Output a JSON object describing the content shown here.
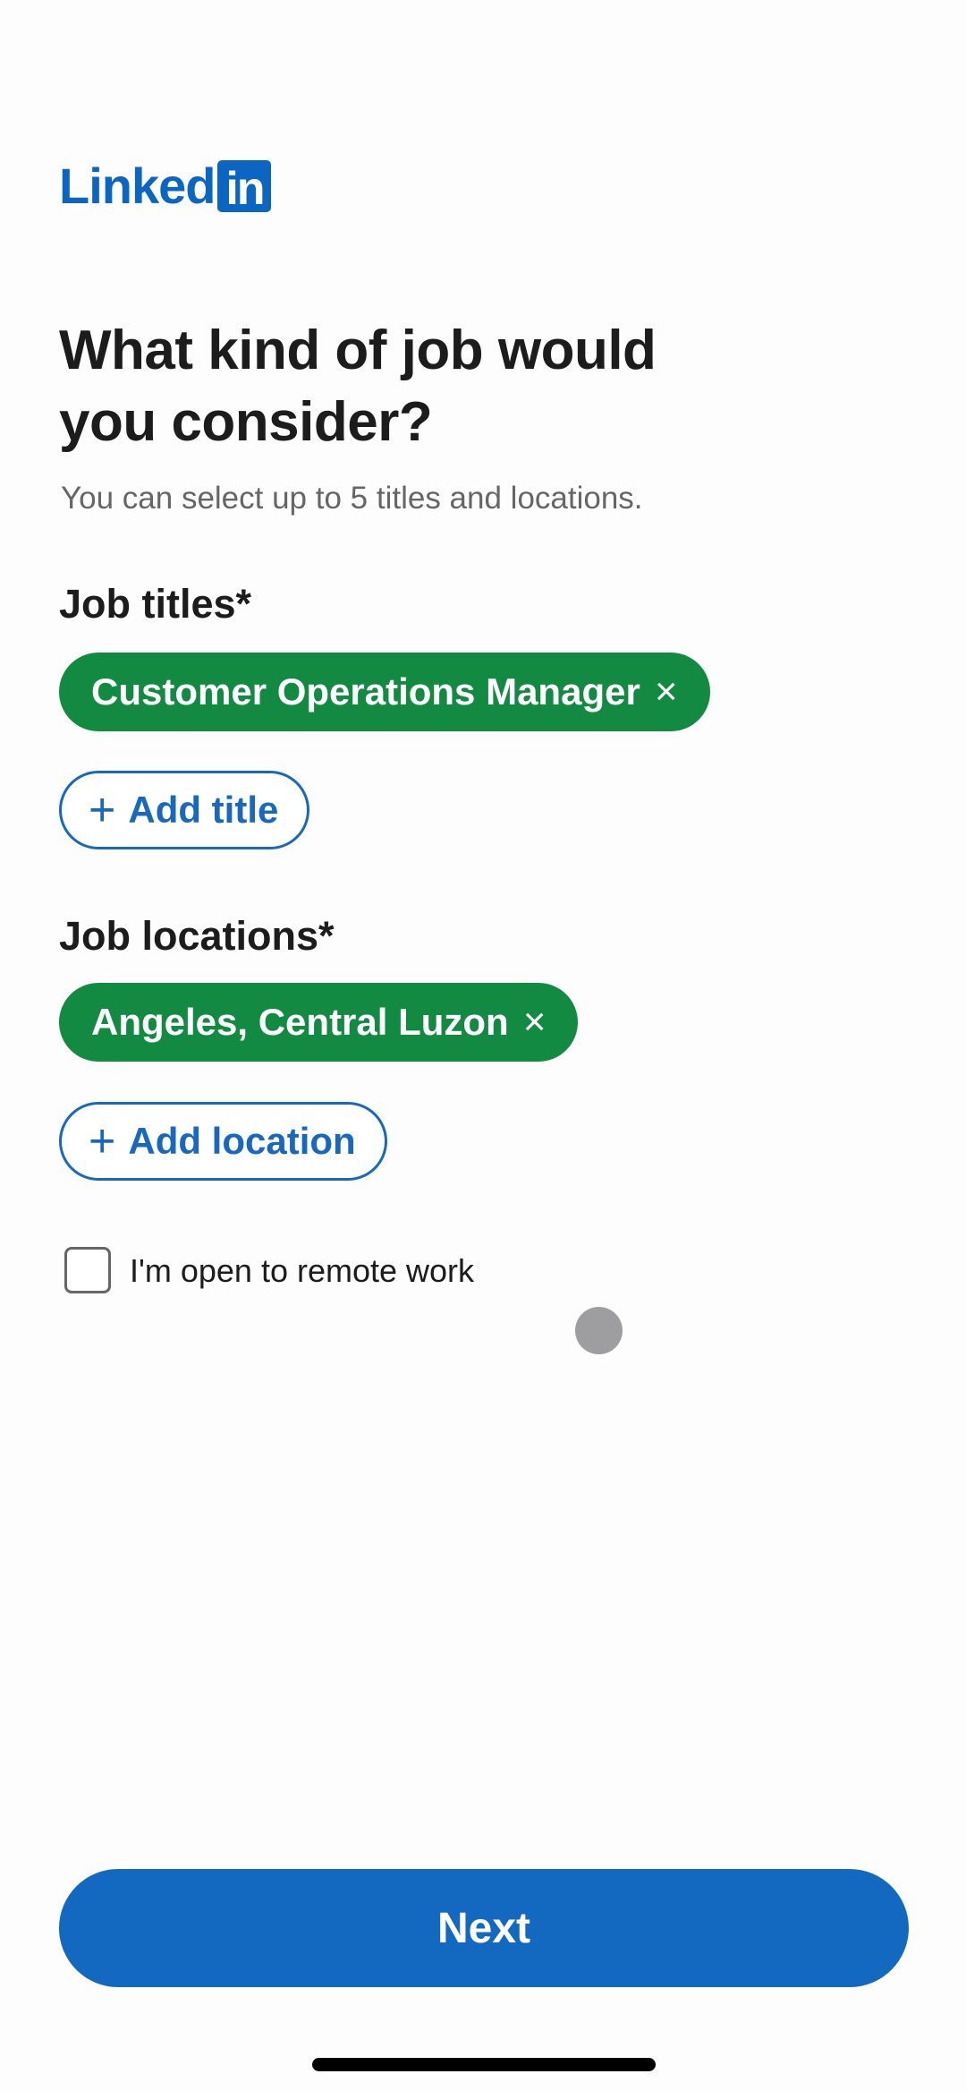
{
  "brand": {
    "logo_text": "Linked",
    "logo_box_text": "in",
    "color": "#0a66c2"
  },
  "page": {
    "title": "What kind of job would you consider?",
    "subtitle": "You can select up to 5 titles and locations."
  },
  "job_titles": {
    "label": "Job titles*",
    "chips": [
      {
        "label": "Customer Operations Manager",
        "remove_icon": "×"
      }
    ],
    "add_button": {
      "icon": "+",
      "label": "Add title"
    }
  },
  "job_locations": {
    "label": "Job locations*",
    "chips": [
      {
        "label": "Angeles, Central Luzon",
        "remove_icon": "×"
      }
    ],
    "add_button": {
      "icon": "+",
      "label": "Add location"
    }
  },
  "remote": {
    "label": "I'm open to remote work",
    "checked": false
  },
  "footer": {
    "next_label": "Next"
  },
  "colors": {
    "chip_green": "#128a42",
    "primary_blue": "#1368bf",
    "text": "#1c1c1c",
    "muted": "#666666"
  }
}
